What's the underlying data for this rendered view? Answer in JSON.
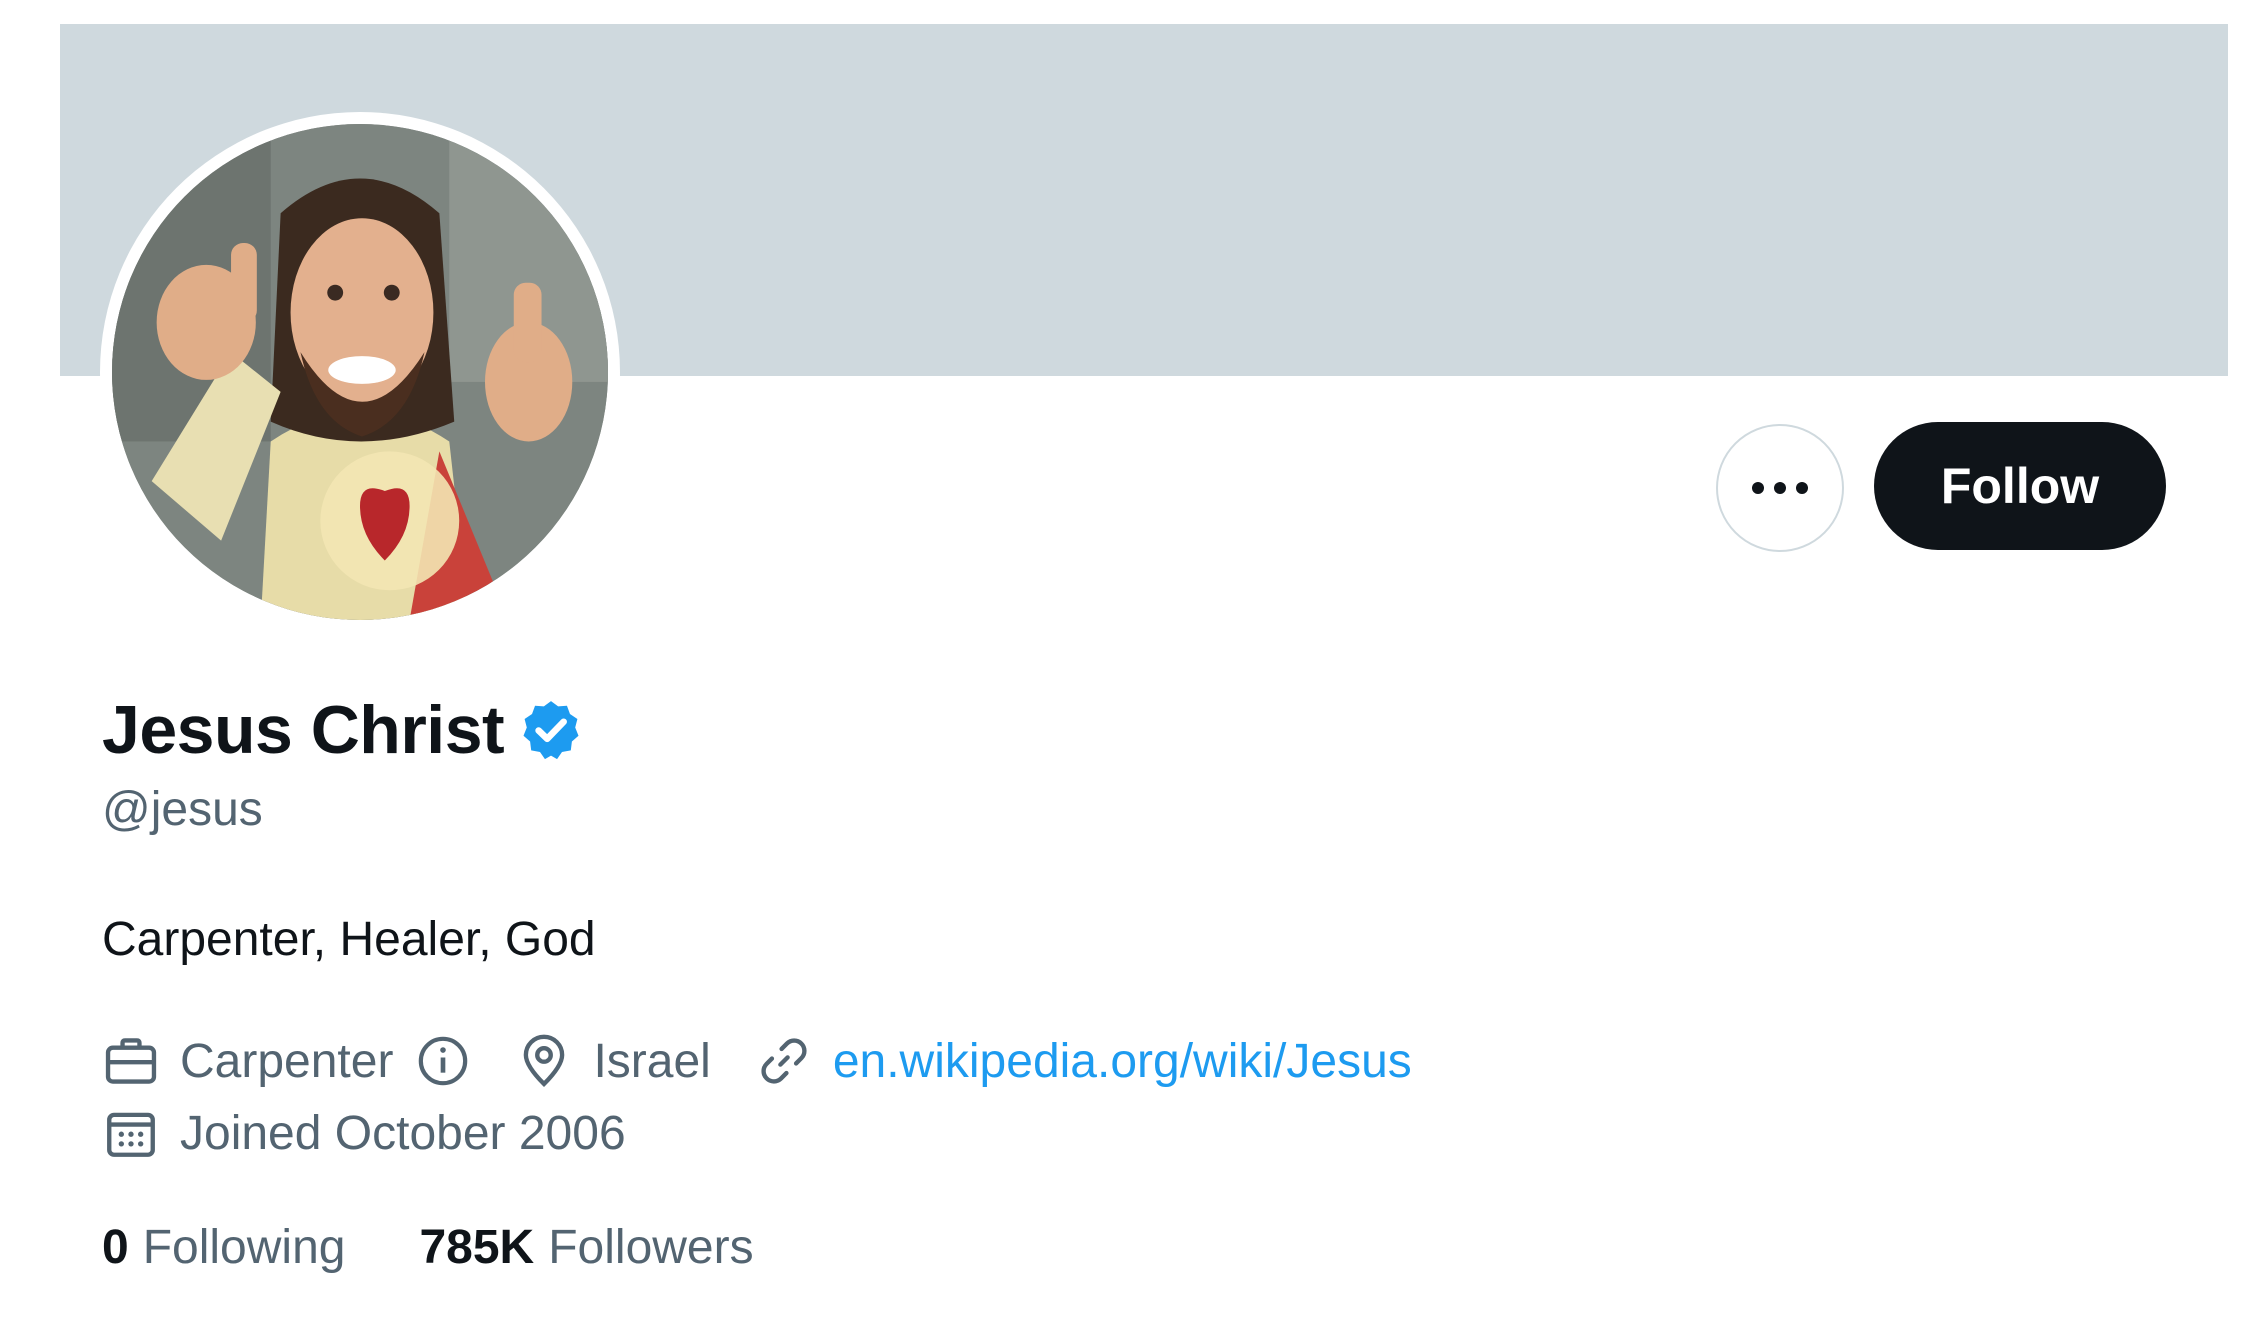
{
  "profile": {
    "display_name": "Jesus Christ",
    "handle": "@jesus",
    "verified": true,
    "bio": "Carpenter, Healer, God",
    "follow_label": "Follow",
    "more_icon": "more-horizontal-icon",
    "meta": {
      "profession": "Carpenter",
      "location": "Israel",
      "website": "en.wikipedia.org/wiki/Jesus",
      "joined": "Joined October 2006"
    },
    "stats": {
      "following_count": "0",
      "following_label": "Following",
      "followers_count": "785K",
      "followers_label": "Followers"
    }
  },
  "colors": {
    "banner": "#cfd9de",
    "accent": "#1d9bf0",
    "text_primary": "#0f1419",
    "text_secondary": "#536471",
    "button_dark": "#0f1419"
  }
}
